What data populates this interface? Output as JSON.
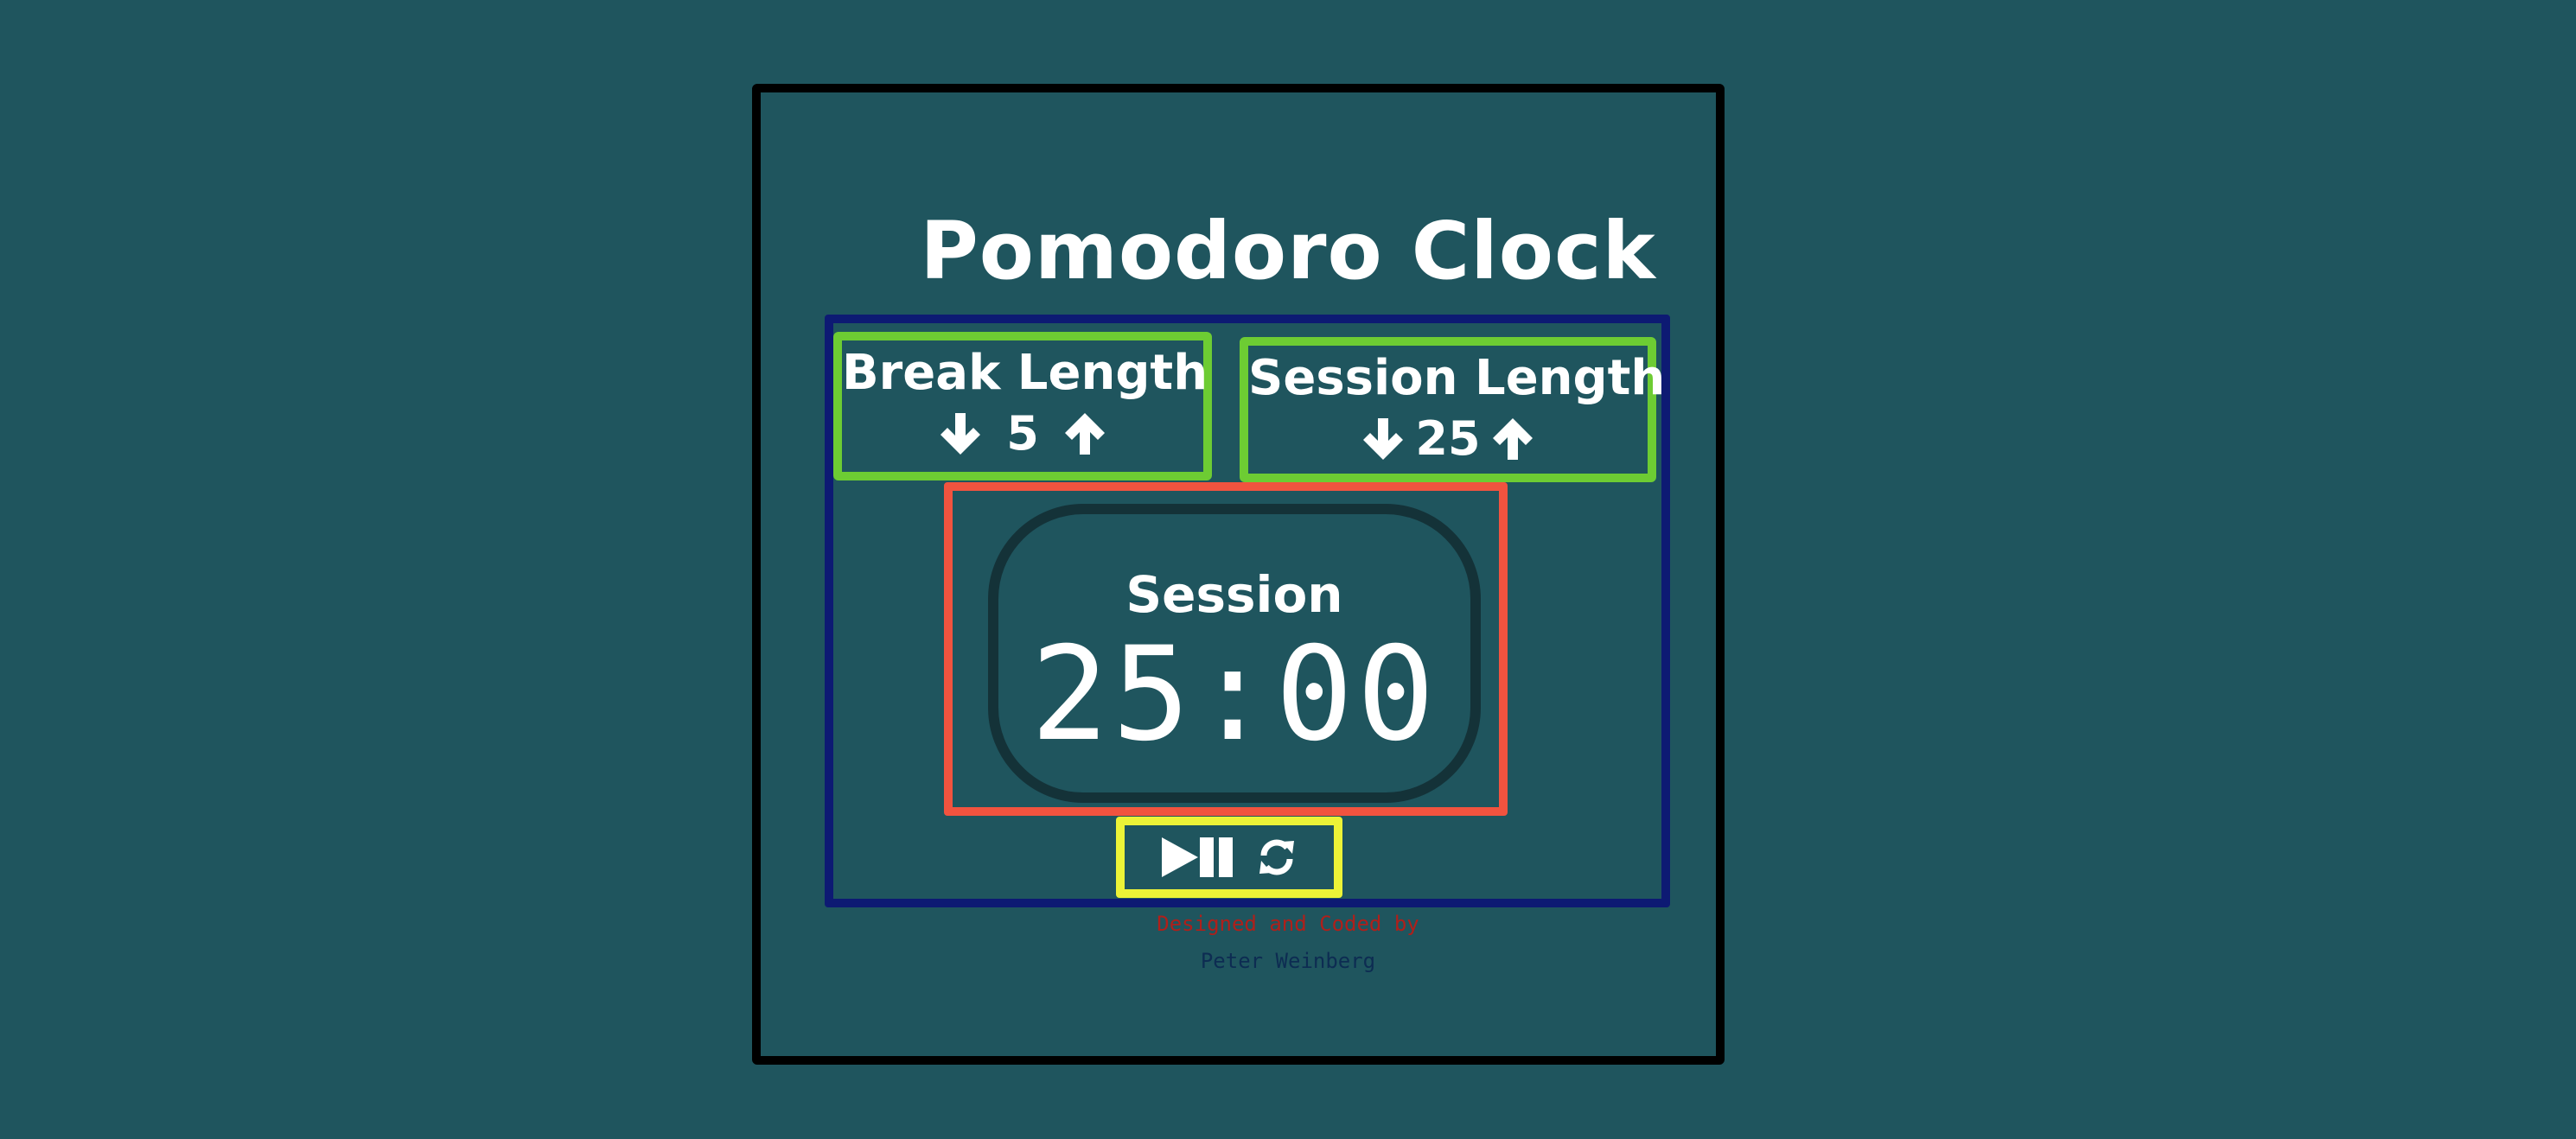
{
  "app": {
    "title": "Pomodoro Clock"
  },
  "break": {
    "label": "Break Length",
    "value": "5",
    "decrement_icon": "arrow-down-icon",
    "increment_icon": "arrow-up-icon"
  },
  "session": {
    "label": "Session Length",
    "value": "25",
    "decrement_icon": "arrow-down-icon",
    "increment_icon": "arrow-up-icon"
  },
  "timer": {
    "label": "Session",
    "display": "25:00"
  },
  "controls": {
    "play_pause_icon": "play-pause-icon",
    "reset_icon": "refresh-icon"
  },
  "footer": {
    "line1": "Designed and Coded by",
    "line2": "Peter Weinberg"
  },
  "colors": {
    "background": "#1f555e",
    "frame": "#000000",
    "main_box": "#0d1a73",
    "length_boxes": "#6dcc33",
    "timer_box": "#f1533f",
    "controls_box": "#ecf337",
    "credit_line1": "#b01f1a",
    "credit_line2": "#0d2c52"
  }
}
